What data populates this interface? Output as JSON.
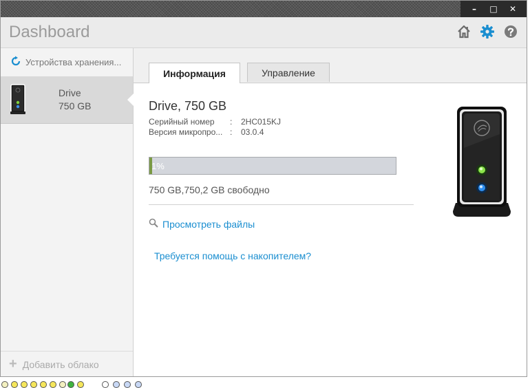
{
  "window": {
    "minimize": "–",
    "maximize": "□",
    "close": "✕"
  },
  "header": {
    "title": "Dashboard",
    "icons": [
      "home-icon",
      "gear-icon",
      "help-icon"
    ],
    "accent_color": "#1a8ed0"
  },
  "sidebar": {
    "storage_label": "Устройства хранения...",
    "device": {
      "name": "Drive",
      "size": "750 GB"
    },
    "add_cloud": "Добавить облако"
  },
  "tabs": {
    "info": "Информация",
    "manage": "Управление"
  },
  "details": {
    "title": "Drive, 750 GB",
    "serial_label": "Серийный номер",
    "serial_value": "2HC015KJ",
    "firmware_label": "Версия микропро...",
    "firmware_value": "03.0.4",
    "colon": ":",
    "usage_percent": 1,
    "usage_label": "1%",
    "free_text": "750 GB,750,2 GB свободно",
    "browse_files": "Просмотреть файлы",
    "help": "Требуется помощь с накопителем?"
  }
}
